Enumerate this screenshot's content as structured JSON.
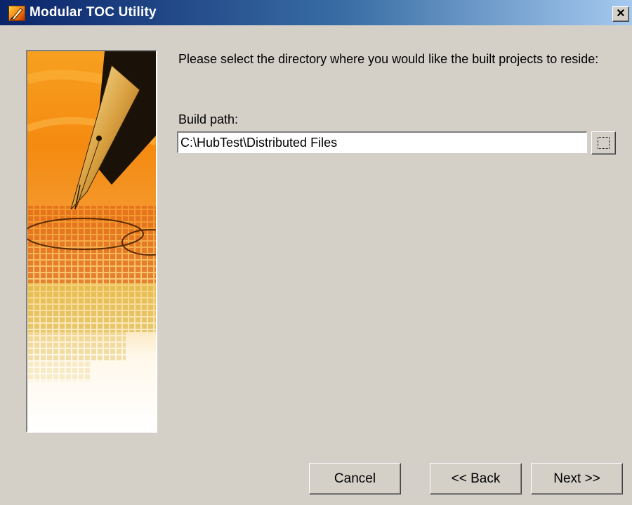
{
  "window": {
    "title": "Modular TOC Utility",
    "close_glyph": "✕",
    "icon": "app-quill-icon"
  },
  "content": {
    "instruction": "Please select the directory where you would like the built projects to reside:",
    "build_path_label": "Build path:",
    "build_path_value": "C:\\HubTest\\Distributed Files",
    "browse_icon": "browse-folder-icon"
  },
  "buttons": {
    "cancel": "Cancel",
    "back": "<< Back",
    "next": "Next >>"
  },
  "colors": {
    "dialog_bg": "#d4d0c8",
    "title_start": "#0a246a",
    "title_end": "#a6caf0",
    "image_orange": "#f08010"
  }
}
